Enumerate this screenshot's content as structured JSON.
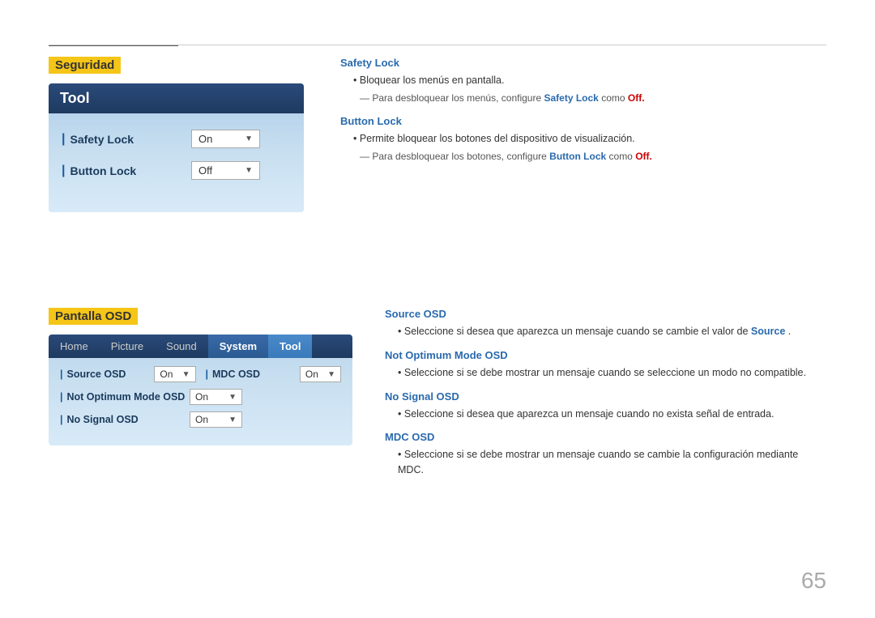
{
  "page": {
    "number": "65"
  },
  "top_section": {
    "header": "Seguridad",
    "tool_box": {
      "title": "Tool",
      "rows": [
        {
          "label": "Safety Lock",
          "value": "On"
        },
        {
          "label": "Button Lock",
          "value": "Off"
        }
      ]
    },
    "info": {
      "safety_lock": {
        "title": "Safety Lock",
        "bullet": "Bloquear los menús en pantalla.",
        "sub": "Para desbloquear los menús, configure",
        "sub_link": "Safety Lock",
        "sub_text": " como ",
        "sub_value": "Off."
      },
      "button_lock": {
        "title": "Button Lock",
        "bullet": "Permite bloquear los botones del dispositivo de visualización.",
        "sub": "Para desbloquear los botones, configure",
        "sub_link": "Button Lock",
        "sub_text": " como ",
        "sub_value": "Off."
      }
    }
  },
  "bottom_section": {
    "header": "Pantalla OSD",
    "osd_box": {
      "tabs": [
        "Home",
        "Picture",
        "Sound",
        "System",
        "Tool"
      ],
      "active_tab": "System",
      "rows": [
        {
          "label": "Source OSD",
          "value": "On",
          "right_label": "MDC OSD",
          "right_value": "On"
        },
        {
          "label": "Not Optimum Mode OSD",
          "value": "On"
        },
        {
          "label": "No Signal OSD",
          "value": "On"
        }
      ]
    },
    "info": {
      "source_osd": {
        "title": "Source OSD",
        "bullet": "Seleccione si desea que aparezca un mensaje cuando se cambie el valor de",
        "bullet_link": "Source",
        "bullet_end": "."
      },
      "not_optimum": {
        "title": "Not Optimum Mode OSD",
        "bullet": "Seleccione si se debe mostrar un mensaje cuando se seleccione un modo no compatible."
      },
      "no_signal": {
        "title": "No Signal OSD",
        "bullet": "Seleccione si desea que aparezca un mensaje cuando no exista señal de entrada."
      },
      "mdc_osd": {
        "title": "MDC OSD",
        "bullet": "Seleccione si se debe mostrar un mensaje cuando se cambie la configuración mediante MDC."
      }
    }
  }
}
